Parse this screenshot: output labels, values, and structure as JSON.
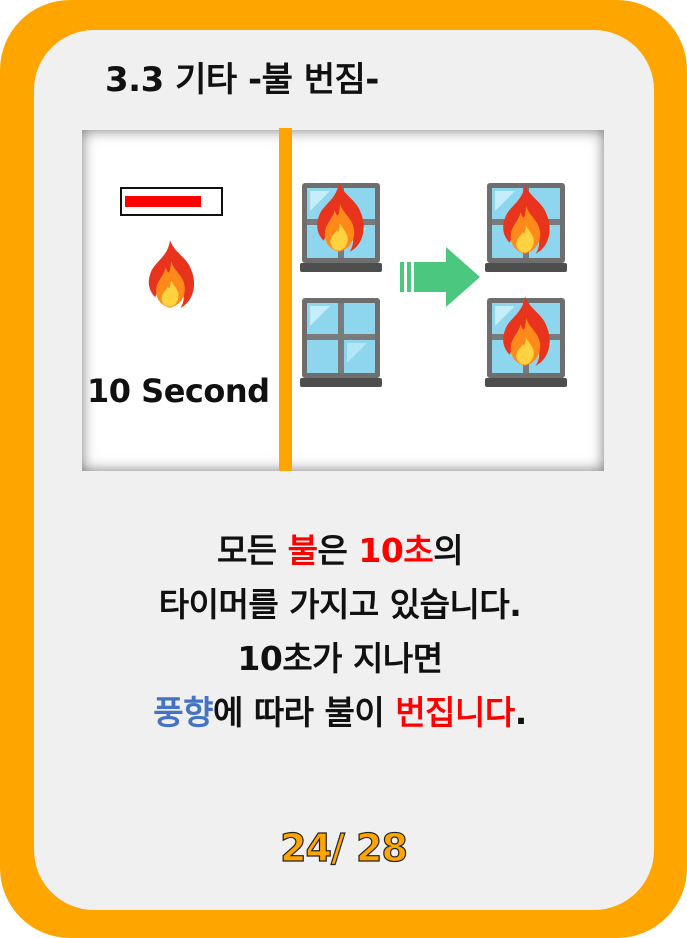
{
  "title": "3.3 기타 -불 번짐-",
  "illustration": {
    "timer_label": "10 Second",
    "timer_fill_fraction": 0.8,
    "icons": {
      "timer_bar": "timer-bar",
      "flame": "flame-icon",
      "window": "window-icon",
      "arrow": "arrow-right-icon"
    }
  },
  "description": {
    "line1": {
      "a": "모든 ",
      "b": "불",
      "c": "은 ",
      "d": "10초",
      "e": "의"
    },
    "line2": "타이머를 가지고 있습니다.",
    "line3": "10초가 지나면",
    "line4": {
      "a": "풍향",
      "b": "에 따라 불이 ",
      "c": "번집니다",
      "d": "."
    }
  },
  "page_indicator": "24/ 28",
  "colors": {
    "frame": "#FFA500",
    "card": "#F0F0F0",
    "highlight_red": "#FF0000",
    "highlight_blue": "#4472C4",
    "arrow": "#4CC77F"
  }
}
